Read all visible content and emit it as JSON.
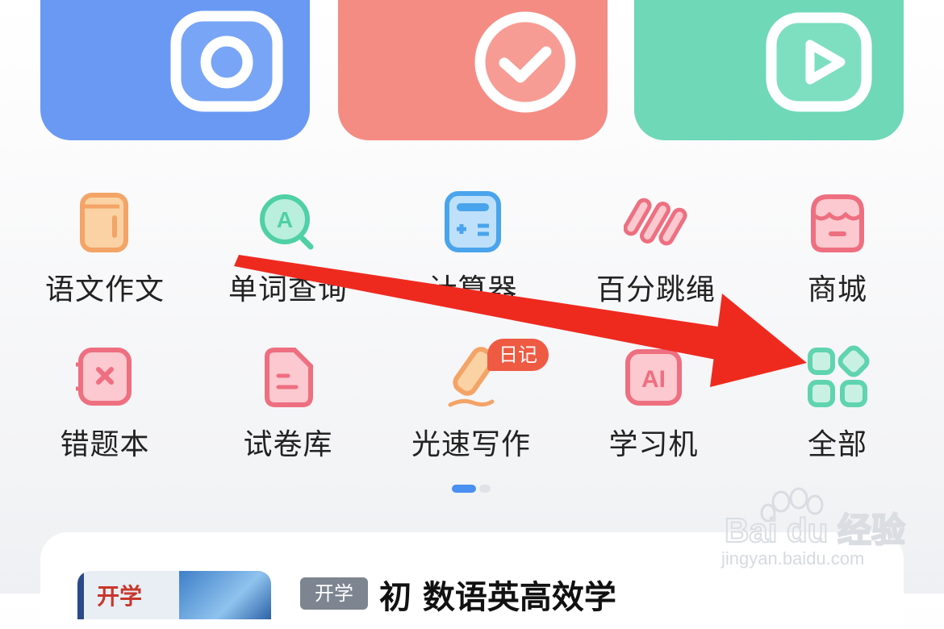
{
  "top_cards": [
    {
      "name": "camera",
      "color": "#6a99f4",
      "icon": "camera-icon"
    },
    {
      "name": "check",
      "color": "#f48c84",
      "icon": "check-circle-icon"
    },
    {
      "name": "video",
      "color": "#6fd8b6",
      "icon": "play-icon"
    }
  ],
  "grid": {
    "row1": [
      {
        "label": "语文作文",
        "icon": "book-icon"
      },
      {
        "label": "单词查询",
        "icon": "word-search-icon"
      },
      {
        "label": "计算器",
        "icon": "calculator-icon"
      },
      {
        "label": "百分跳绳",
        "icon": "jump-rope-icon"
      },
      {
        "label": "商城",
        "icon": "shop-icon"
      }
    ],
    "row2": [
      {
        "label": "错题本",
        "icon": "wrong-notebook-icon"
      },
      {
        "label": "试卷库",
        "icon": "test-paper-icon"
      },
      {
        "label": "光速写作",
        "icon": "pen-write-icon"
      },
      {
        "label": "学习机",
        "icon": "ai-learning-icon"
      },
      {
        "label": "全部",
        "icon": "all-apps-icon"
      }
    ]
  },
  "badge": "日记",
  "pager": {
    "pages": 2,
    "active": 1
  },
  "article": {
    "thumb_text": "开学",
    "tag": "开学",
    "title": "初 数语英高效学"
  },
  "watermark": {
    "brand": "Bai du 经验",
    "url": "jingyan.baidu.com"
  },
  "colors": {
    "arrow": "#ee2a1f",
    "accent_green": "#5fd4ae"
  }
}
